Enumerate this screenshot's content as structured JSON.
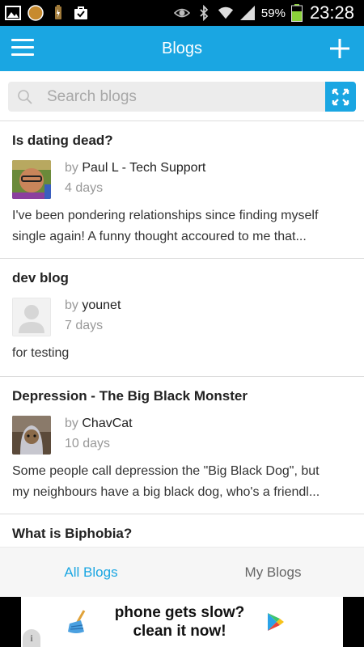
{
  "status_bar": {
    "battery_percent": "59%",
    "time": "23:28",
    "icons": [
      "gallery-icon",
      "circle-app-icon",
      "battery-saver-icon",
      "bag-check-icon",
      "eye-icon",
      "bluetooth-icon",
      "wifi-icon",
      "signal-icon",
      "battery-icon"
    ]
  },
  "appbar": {
    "title": "Blogs",
    "menu_icon": "hamburger-menu-icon",
    "add_icon": "plus-icon"
  },
  "search": {
    "placeholder": "Search blogs",
    "icon": "search-icon",
    "expand_icon": "expand-arrows-icon"
  },
  "posts": [
    {
      "title": "Is dating dead?",
      "by": "by",
      "author": "Paul L - Tech Support",
      "age": "4 days",
      "excerpt_line1": "I've been pondering relationships since finding myself",
      "excerpt_line2": "single again! A funny thought accoured to me that..."
    },
    {
      "title": "dev blog",
      "by": "by",
      "author": "younet",
      "age": "7 days",
      "excerpt_line1": "for testing",
      "excerpt_line2": ""
    },
    {
      "title": "Depression - The Big Black Monster",
      "by": "by",
      "author": "ChavCat",
      "age": "10 days",
      "excerpt_line1": "Some people call depression the \"Big Black Dog\", but",
      "excerpt_line2": "my neighbours have a big black dog, who's a friendl..."
    },
    {
      "title": "What is Biphobia?"
    }
  ],
  "tabs": {
    "all": "All Blogs",
    "mine": "My Blogs"
  },
  "ad": {
    "line1": "phone gets slow?",
    "line2": "clean it now!",
    "info": "i"
  },
  "colors": {
    "accent": "#1aa6e2",
    "statusbar": "#000000",
    "tab_bg": "#f6f6f6"
  }
}
